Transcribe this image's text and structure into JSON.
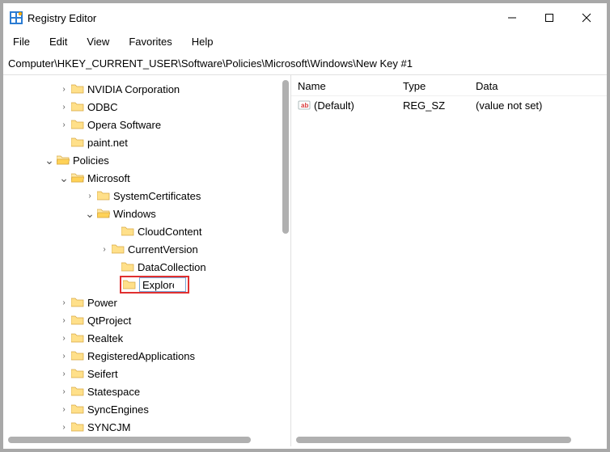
{
  "window": {
    "title": "Registry Editor"
  },
  "menu": {
    "file": "File",
    "edit": "Edit",
    "view": "View",
    "favorites": "Favorites",
    "help": "Help"
  },
  "address": "Computer\\HKEY_CURRENT_USER\\Software\\Policies\\Microsoft\\Windows\\New Key #1",
  "tree": [
    {
      "indent": 68,
      "expander": ">",
      "label": "NVIDIA Corporation"
    },
    {
      "indent": 68,
      "expander": ">",
      "label": "ODBC"
    },
    {
      "indent": 68,
      "expander": ">",
      "label": "Opera Software"
    },
    {
      "indent": 68,
      "expander": "",
      "label": "paint.net"
    },
    {
      "indent": 50,
      "expander": "v",
      "label": "Policies",
      "open": true
    },
    {
      "indent": 68,
      "expander": "v",
      "label": "Microsoft",
      "open": true
    },
    {
      "indent": 100,
      "expander": ">",
      "label": "SystemCertificates"
    },
    {
      "indent": 100,
      "expander": "v",
      "label": "Windows",
      "open": true
    },
    {
      "indent": 130,
      "expander": "",
      "label": "CloudContent"
    },
    {
      "indent": 118,
      "expander": ">",
      "label": "CurrentVersion"
    },
    {
      "indent": 130,
      "expander": "",
      "label": "DataCollection"
    },
    {
      "indent": 130,
      "expander": "",
      "label": "Explorer",
      "editing": true,
      "highlight": true
    },
    {
      "indent": 68,
      "expander": ">",
      "label": "Power"
    },
    {
      "indent": 68,
      "expander": ">",
      "label": "QtProject"
    },
    {
      "indent": 68,
      "expander": ">",
      "label": "Realtek"
    },
    {
      "indent": 68,
      "expander": ">",
      "label": "RegisteredApplications"
    },
    {
      "indent": 68,
      "expander": ">",
      "label": "Seifert"
    },
    {
      "indent": 68,
      "expander": ">",
      "label": "Statespace"
    },
    {
      "indent": 68,
      "expander": ">",
      "label": "SyncEngines"
    },
    {
      "indent": 68,
      "expander": ">",
      "label": "SYNCJM"
    }
  ],
  "list": {
    "headers": {
      "name": "Name",
      "type": "Type",
      "data": "Data"
    },
    "rows": [
      {
        "name": "(Default)",
        "type": "REG_SZ",
        "data": "(value not set)"
      }
    ]
  }
}
